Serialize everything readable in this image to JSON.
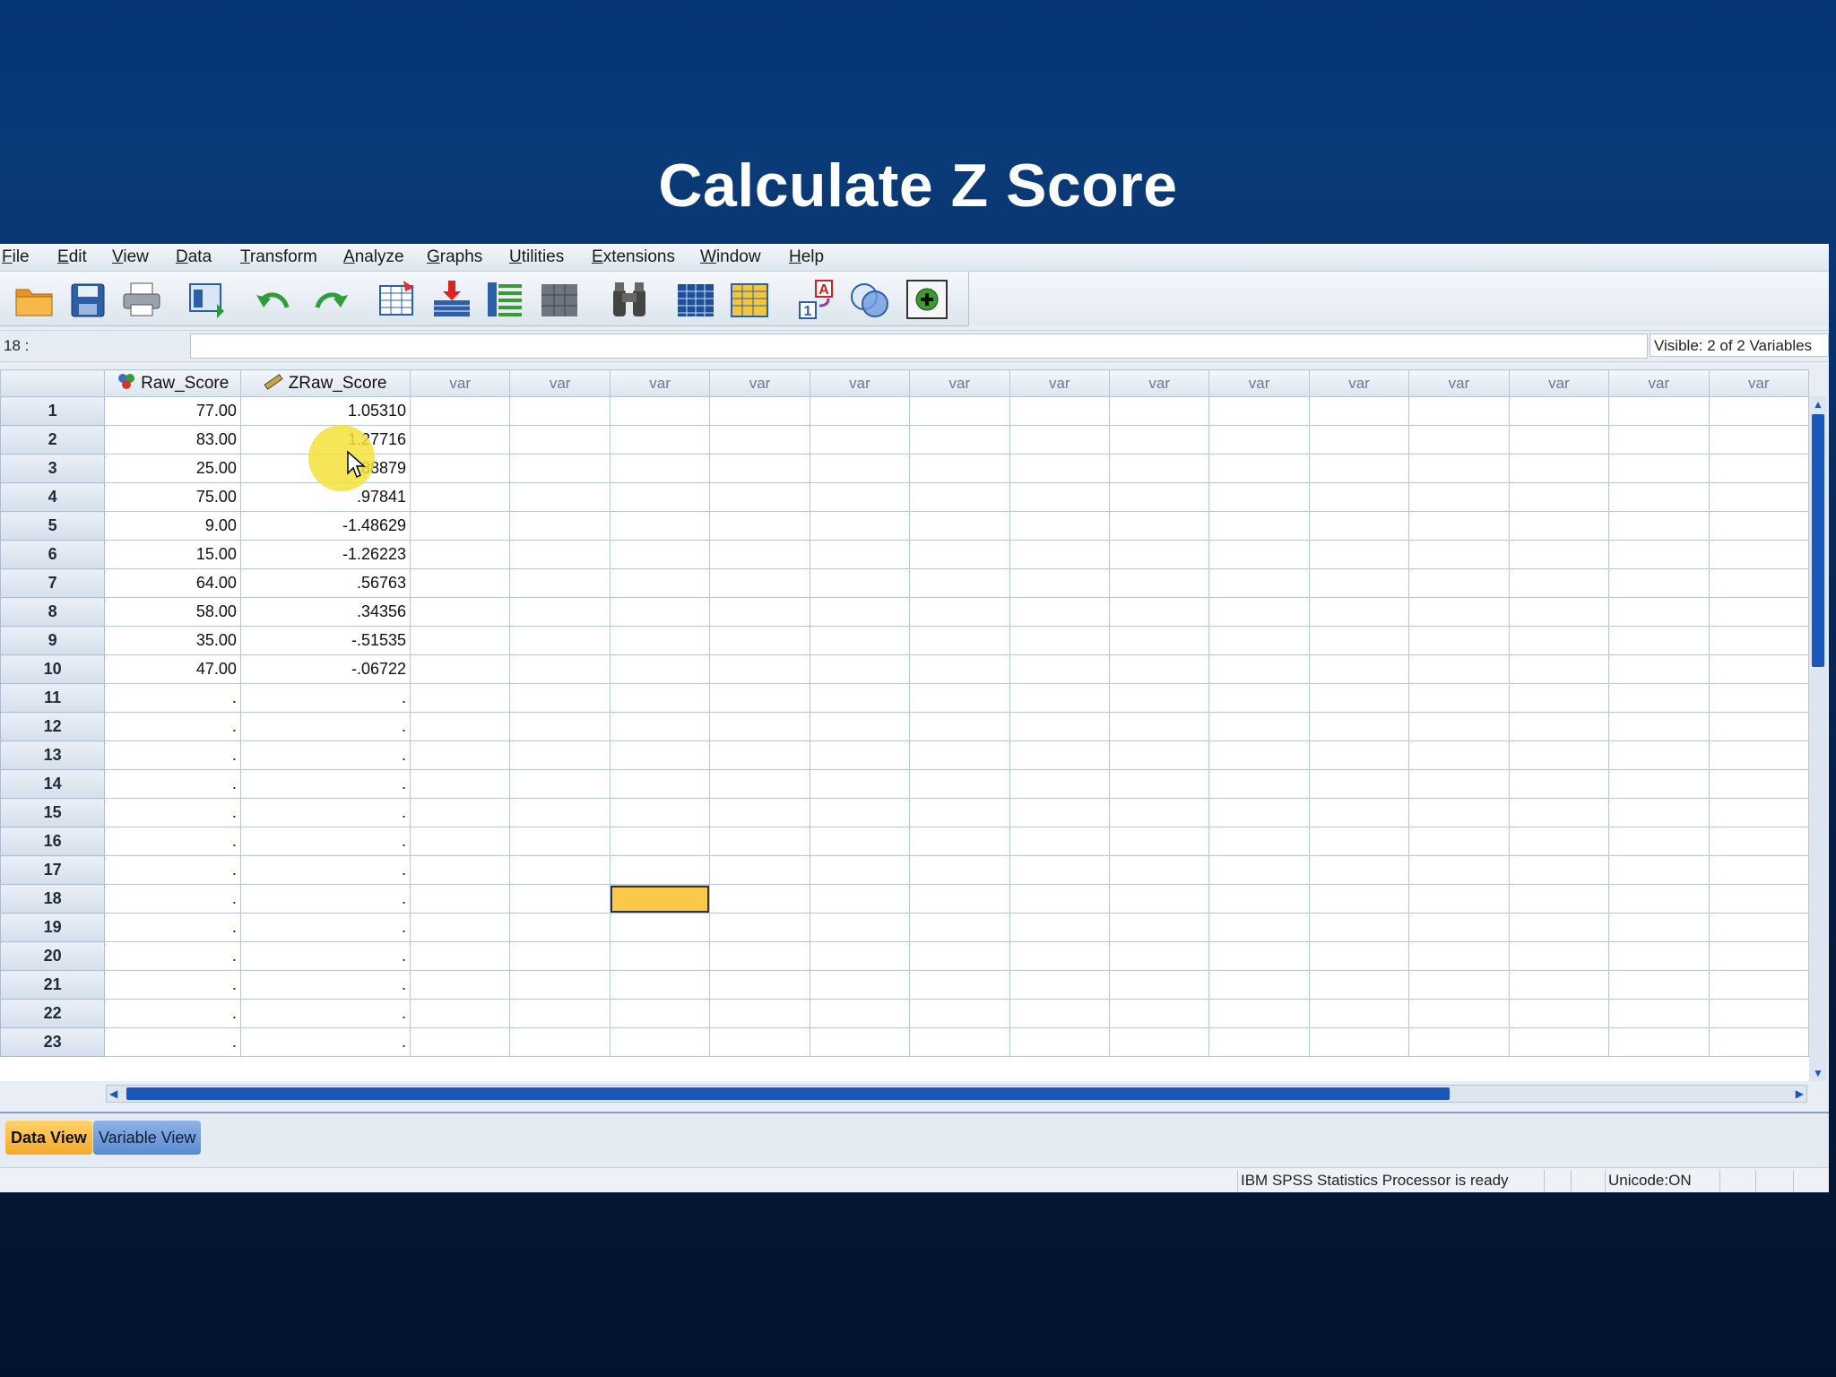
{
  "slide": {
    "title": "Calculate Z Score"
  },
  "menu": [
    "File",
    "Edit",
    "View",
    "Data",
    "Transform",
    "Analyze",
    "Graphs",
    "Utilities",
    "Extensions",
    "Window",
    "Help"
  ],
  "toolbar": {
    "icons": [
      "open-folder-icon",
      "save-icon",
      "print-icon",
      "recall-dialog-icon",
      "undo-icon",
      "redo-icon",
      "goto-case-icon",
      "goto-variable-icon",
      "variables-icon",
      "run-descriptives-icon",
      "find-icon",
      "insert-cases-icon",
      "insert-variable-icon",
      "value-labels-icon",
      "use-variable-sets-icon",
      "show-all-variables-icon"
    ]
  },
  "editbar": {
    "cell_ref": "18 :",
    "cell_value": "",
    "visible": "Visible: 2 of 2 Variables"
  },
  "grid": {
    "columns": [
      "Raw_Score",
      "ZRaw_Score",
      "var",
      "var",
      "var",
      "var",
      "var",
      "var",
      "var",
      "var",
      "var",
      "var",
      "var",
      "var",
      "var",
      "var"
    ],
    "rows": [
      [
        "1",
        "77.00",
        "1.05310"
      ],
      [
        "2",
        "83.00",
        "1.27716"
      ],
      [
        "3",
        "25.00",
        "-.88879"
      ],
      [
        "4",
        "75.00",
        ".97841"
      ],
      [
        "5",
        "9.00",
        "-1.48629"
      ],
      [
        "6",
        "15.00",
        "-1.26223"
      ],
      [
        "7",
        "64.00",
        ".56763"
      ],
      [
        "8",
        "58.00",
        ".34356"
      ],
      [
        "9",
        "35.00",
        "-.51535"
      ],
      [
        "10",
        "47.00",
        "-.06722"
      ],
      [
        "11",
        ".",
        "."
      ],
      [
        "12",
        ".",
        "."
      ],
      [
        "13",
        ".",
        "."
      ],
      [
        "14",
        ".",
        "."
      ],
      [
        "15",
        ".",
        "."
      ],
      [
        "16",
        ".",
        "."
      ],
      [
        "17",
        ".",
        "."
      ],
      [
        "18",
        ".",
        "."
      ],
      [
        "19",
        ".",
        "."
      ],
      [
        "20",
        ".",
        "."
      ],
      [
        "21",
        ".",
        "."
      ],
      [
        "22",
        ".",
        "."
      ],
      [
        "23",
        ".",
        "."
      ]
    ],
    "selected_cell": {
      "row": "18",
      "column_index": 4
    }
  },
  "tabs": {
    "data_view": "Data View",
    "variable_view": "Variable View"
  },
  "status": {
    "processor": "IBM SPSS Statistics Processor is ready",
    "unicode": "Unicode:ON"
  },
  "colors": {
    "selected_cell": "#fcc84a",
    "scroll_thumb": "#1b57b8",
    "highlight": "#f4e03a"
  }
}
